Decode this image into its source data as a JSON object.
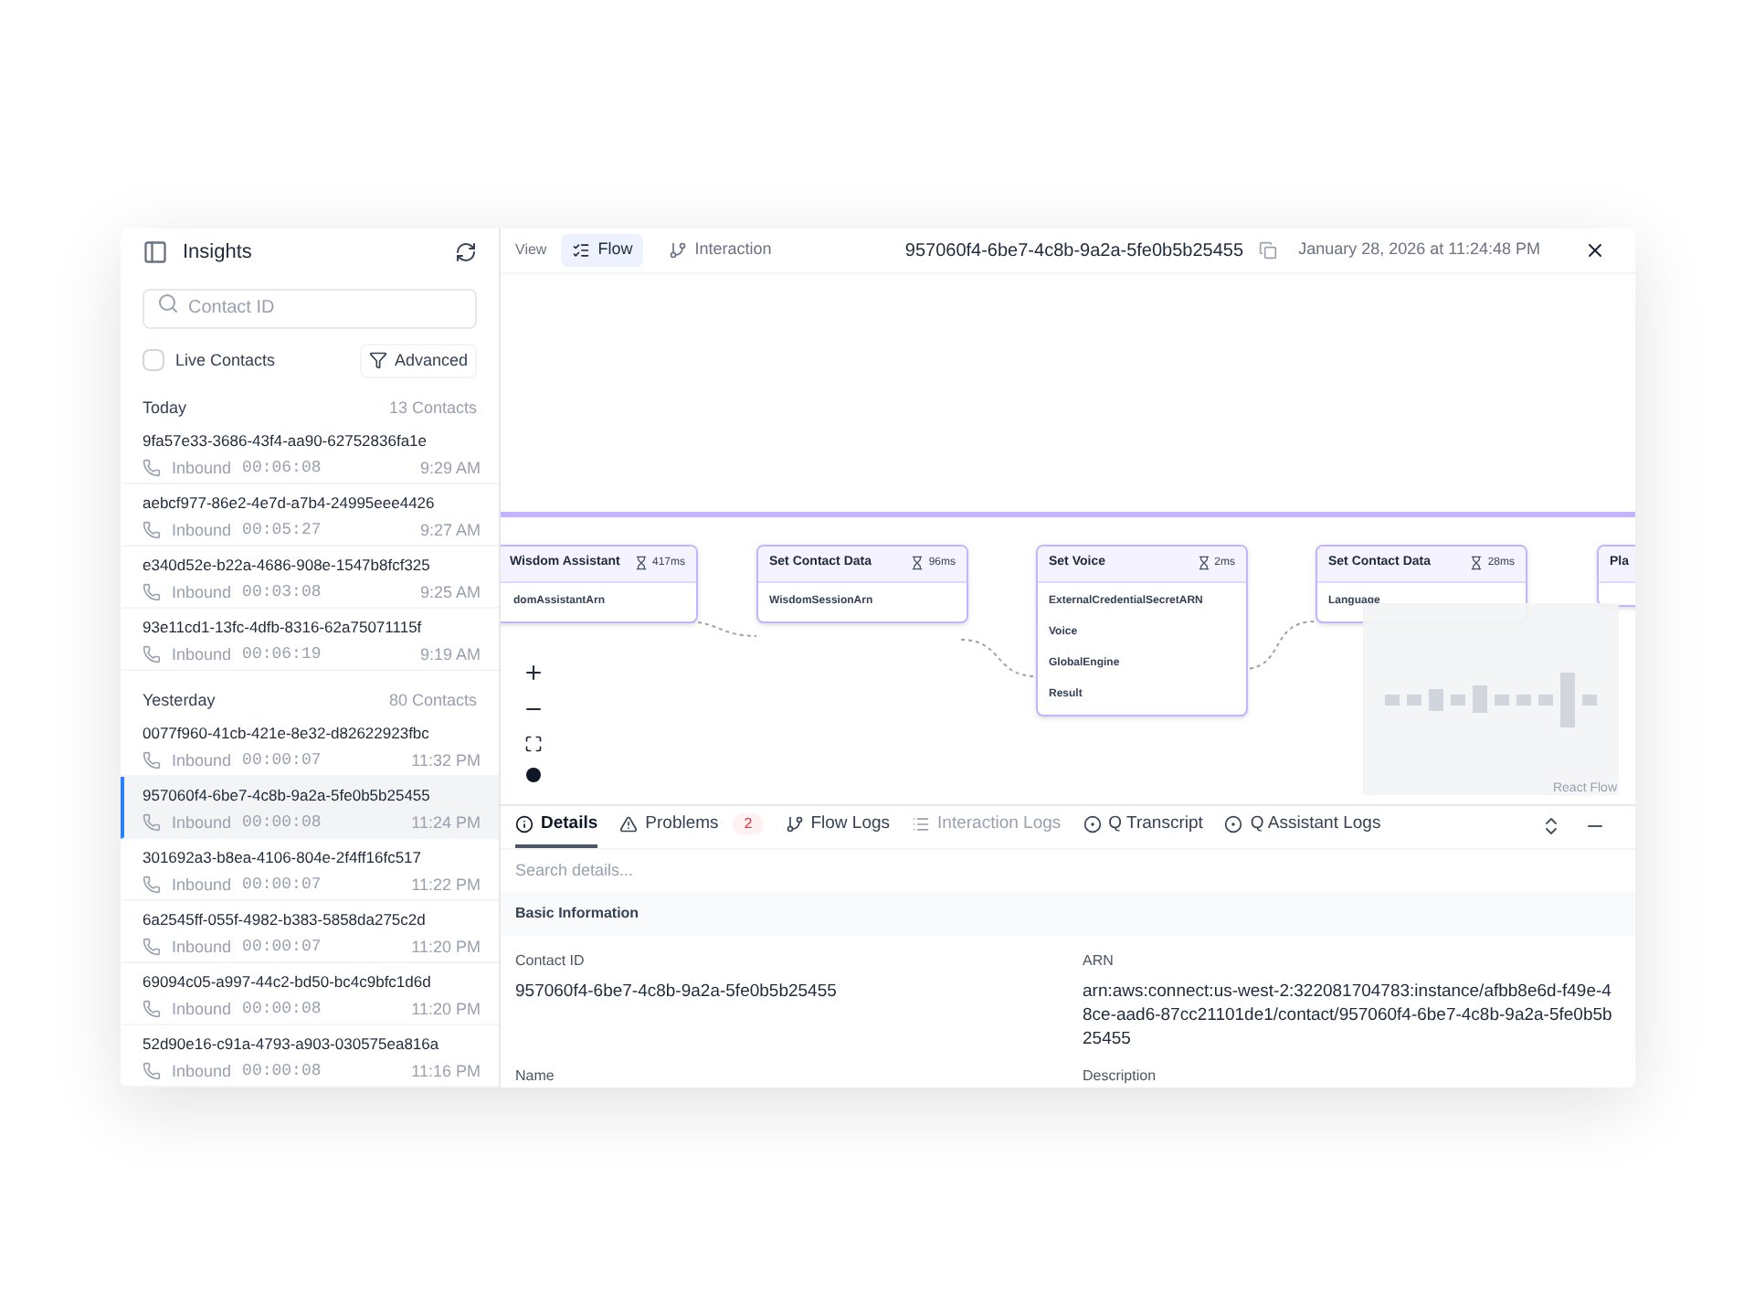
{
  "sidebar": {
    "title": "Insights",
    "search": {
      "placeholder": "Contact ID"
    },
    "live_contacts": {
      "label": "Live Contacts",
      "checked": false
    },
    "advanced_button": "Advanced",
    "groups": [
      {
        "label": "Today",
        "count": "13 Contacts",
        "contacts": [
          {
            "id": "9fa57e33-3686-43f4-aa90-62752836fa1e",
            "direction": "Inbound",
            "duration": "00:06:08",
            "time": "9:29 AM",
            "selected": false
          },
          {
            "id": "aebcf977-86e2-4e7d-a7b4-24995eee4426",
            "direction": "Inbound",
            "duration": "00:05:27",
            "time": "9:27 AM",
            "selected": false
          },
          {
            "id": "e340d52e-b22a-4686-908e-1547b8fcf325",
            "direction": "Inbound",
            "duration": "00:03:08",
            "time": "9:25 AM",
            "selected": false
          },
          {
            "id": "93e11cd1-13fc-4dfb-8316-62a75071115f",
            "direction": "Inbound",
            "duration": "00:06:19",
            "time": "9:19 AM",
            "selected": false
          }
        ]
      },
      {
        "label": "Yesterday",
        "count": "80 Contacts",
        "contacts": [
          {
            "id": "0077f960-41cb-421e-8e32-d82622923fbc",
            "direction": "Inbound",
            "duration": "00:00:07",
            "time": "11:32 PM",
            "selected": false
          },
          {
            "id": "957060f4-6be7-4c8b-9a2a-5fe0b5b25455",
            "direction": "Inbound",
            "duration": "00:00:08",
            "time": "11:24 PM",
            "selected": true
          },
          {
            "id": "301692a3-b8ea-4106-804e-2f4ff16fc517",
            "direction": "Inbound",
            "duration": "00:00:07",
            "time": "11:22 PM",
            "selected": false
          },
          {
            "id": "6a2545ff-055f-4982-b383-5858da275c2d",
            "direction": "Inbound",
            "duration": "00:00:07",
            "time": "11:20 PM",
            "selected": false
          },
          {
            "id": "69094c05-a997-44c2-bd50-bc4c9bfc1d6d",
            "direction": "Inbound",
            "duration": "00:00:08",
            "time": "11:20 PM",
            "selected": false
          },
          {
            "id": "52d90e16-c91a-4793-a903-030575ea816a",
            "direction": "Inbound",
            "duration": "00:00:08",
            "time": "11:16 PM",
            "selected": false
          }
        ]
      }
    ]
  },
  "header": {
    "view_label": "View",
    "views": [
      {
        "label": "Flow",
        "selected": true
      },
      {
        "label": "Interaction",
        "selected": false
      }
    ],
    "contact_id": "957060f4-6be7-4c8b-9a2a-5fe0b5b25455",
    "timestamp": "January 28, 2026 at 11:24:48 PM"
  },
  "canvas": {
    "nodes": [
      {
        "title": "Wisdom Assistant",
        "duration": "417ms",
        "fields": [
          "domAssistantArn"
        ]
      },
      {
        "title": "Set Contact Data",
        "duration": "96ms",
        "fields": [
          "WisdomSessionArn"
        ]
      },
      {
        "title": "Set Voice",
        "duration": "2ms",
        "fields": [
          "ExternalCredentialSecretARN",
          "Voice",
          "GlobalEngine",
          "Result"
        ]
      },
      {
        "title": "Set Contact Data",
        "duration": "28ms",
        "fields": [
          "Language"
        ]
      },
      {
        "title": "Pla"
      }
    ],
    "attribution": "React Flow"
  },
  "details": {
    "tabs": [
      {
        "label": "Details",
        "selected": true,
        "disabled": false
      },
      {
        "label": "Problems",
        "selected": false,
        "disabled": false,
        "badge": "2"
      },
      {
        "label": "Flow Logs",
        "selected": false,
        "disabled": false
      },
      {
        "label": "Interaction Logs",
        "selected": false,
        "disabled": true
      },
      {
        "label": "Q Transcript",
        "selected": false,
        "disabled": false
      },
      {
        "label": "Q Assistant Logs",
        "selected": false,
        "disabled": false
      }
    ],
    "search": {
      "placeholder": "Search details..."
    },
    "section": "Basic Information",
    "fields": [
      {
        "label": "Contact ID",
        "value": "957060f4-6be7-4c8b-9a2a-5fe0b5b25455"
      },
      {
        "label": "ARN",
        "value": "arn:aws:connect:us-west-2:322081704783:instance/afbb8e6d-f49e-48ce-aad6-87cc21101de1/contact/957060f4-6be7-4c8b-9a2a-5fe0b5b25455"
      },
      {
        "label": "Name"
      },
      {
        "label": "Description"
      }
    ]
  }
}
